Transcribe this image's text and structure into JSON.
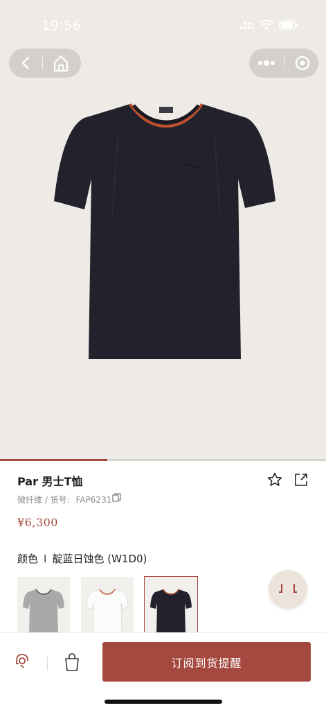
{
  "status_bar": {
    "time": "19:56"
  },
  "product": {
    "title": "Par 男士T恤",
    "material": "微纤维 / 货号:",
    "sku": "FAP6231",
    "price": "¥6,300",
    "gallery_progress": 0.33
  },
  "color": {
    "label": "颜色",
    "separator": "I",
    "selected": "靛蓝日蚀色 (W1D0)",
    "swatches": [
      {
        "name": "grey",
        "color": "#a9a9ab"
      },
      {
        "name": "white",
        "color": "#f7f7f5"
      },
      {
        "name": "navy",
        "color": "#23222c"
      }
    ]
  },
  "cta": {
    "label": "订阅到货提醒"
  },
  "colors": {
    "accent": "#a5483f",
    "hero_bg": "#eeebe6",
    "shirt": "#23222c",
    "trim": "#c2522f"
  }
}
